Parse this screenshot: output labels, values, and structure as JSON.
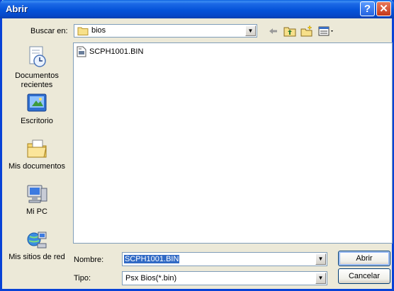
{
  "window": {
    "title": "Abrir",
    "help_label": "?",
    "close_label": "✕"
  },
  "lookin": {
    "label": "Buscar en:",
    "folder": "bios",
    "folder_icon": "folder-icon"
  },
  "toolbar": {
    "back_icon": "back-arrow-icon",
    "up_icon": "up-folder-icon",
    "newfolder_icon": "new-folder-icon",
    "views_icon": "views-menu-icon"
  },
  "places": [
    {
      "label_line1": "Documentos",
      "label_line2": "recientes",
      "icon": "recent-documents-icon"
    },
    {
      "label_line1": "Escritorio",
      "label_line2": "",
      "icon": "desktop-icon"
    },
    {
      "label_line1": "Mis documentos",
      "label_line2": "",
      "icon": "my-documents-icon"
    },
    {
      "label_line1": "Mi PC",
      "label_line2": "",
      "icon": "my-computer-icon"
    },
    {
      "label_line1": "Mis sitios de red",
      "label_line2": "",
      "icon": "network-places-icon"
    }
  ],
  "files": [
    {
      "name": "SCPH1001.BIN",
      "icon": "file-icon"
    }
  ],
  "filename": {
    "label": "Nombre:",
    "value": "SCPH1001.BIN"
  },
  "filetype": {
    "label": "Tipo:",
    "value": "Psx Bios(*.bin)"
  },
  "buttons": {
    "open": "Abrir",
    "cancel": "Cancelar"
  },
  "colors": {
    "titlebar": "#0553D9",
    "dialog_bg": "#ECE9D8",
    "selection": "#316AC5"
  }
}
